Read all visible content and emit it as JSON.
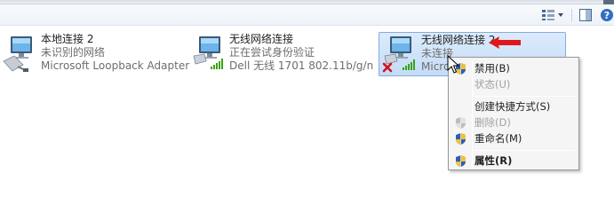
{
  "toolbar": {
    "views_icon": "views-icon",
    "preview_icon": "preview-pane-icon",
    "help_icon": "help-icon"
  },
  "connections": [
    {
      "name": "本地连接 2",
      "status": "未识别的网络",
      "device": "Microsoft Loopback Adapter",
      "icon": "wired-network-icon"
    },
    {
      "name": "无线网络连接",
      "status": "正在尝试身份验证",
      "device": "Dell 无线 1701 802.11b/g/n",
      "icon": "wireless-network-icon"
    },
    {
      "name": "无线网络连接 2",
      "status": "未连接",
      "device": "Micro",
      "icon": "wireless-disconnected-icon",
      "selected": true
    }
  ],
  "context_menu": {
    "items": [
      {
        "label": "禁用(B)",
        "icon": "uac-shield-icon",
        "enabled": true,
        "default": false
      },
      {
        "label": "状态(U)",
        "icon": "",
        "enabled": false,
        "default": false
      },
      {
        "label": "创建快捷方式(S)",
        "icon": "",
        "enabled": true,
        "default": false
      },
      {
        "label": "删除(D)",
        "icon": "uac-shield-icon",
        "enabled": false,
        "default": false
      },
      {
        "label": "重命名(M)",
        "icon": "uac-shield-icon",
        "enabled": true,
        "default": false
      },
      {
        "label": "属性(R)",
        "icon": "uac-shield-icon",
        "enabled": true,
        "default": true
      }
    ]
  },
  "colors": {
    "selection_bg": "#c4dcf6",
    "selection_border": "#84acdd",
    "annotation_arrow": "#e0161b",
    "signal_green": "#3aa317",
    "error_red": "#d4101a"
  }
}
